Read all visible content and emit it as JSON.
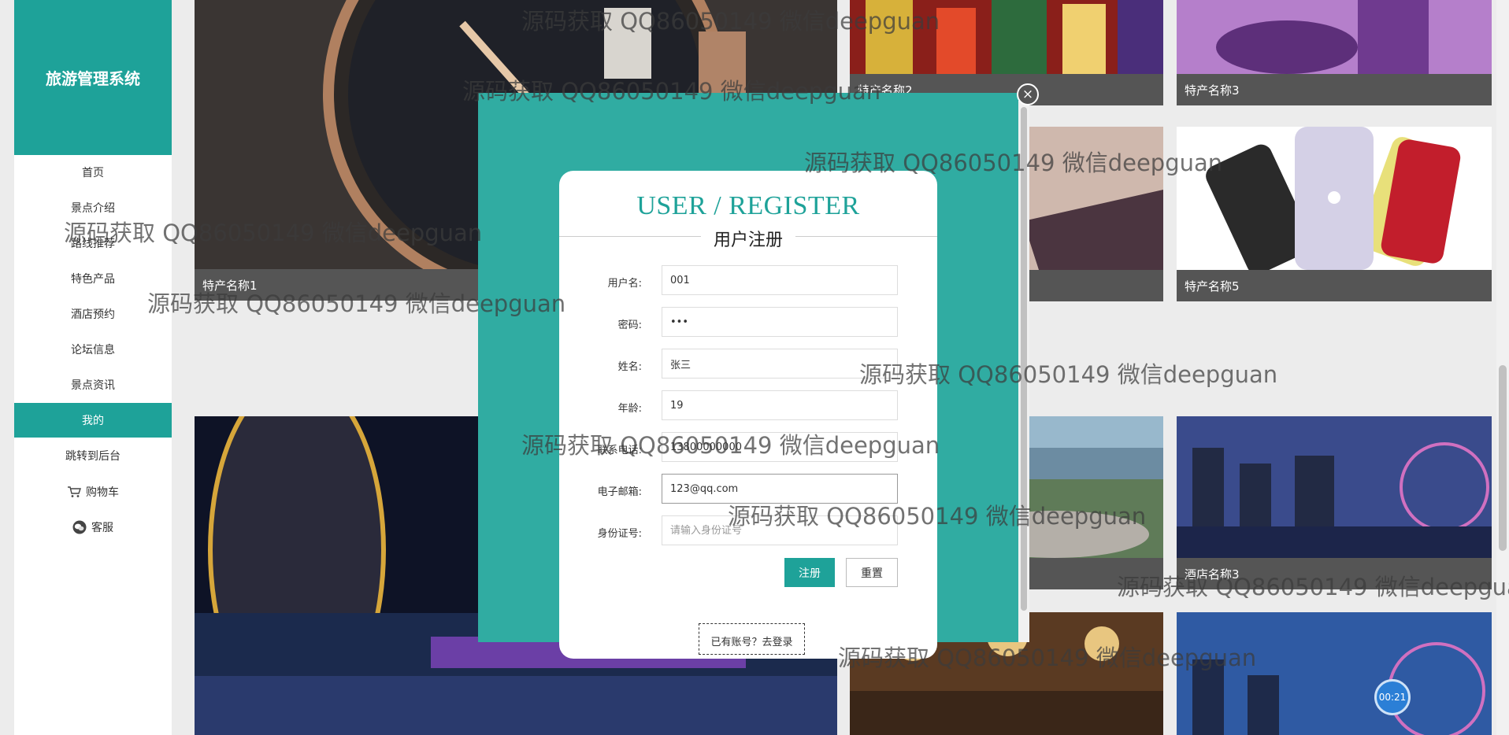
{
  "app": {
    "brand": "旅游管理系统"
  },
  "sidebar": {
    "items": [
      {
        "label": "首页"
      },
      {
        "label": "景点介绍"
      },
      {
        "label": "路线推荐"
      },
      {
        "label": "特色产品"
      },
      {
        "label": "酒店预约"
      },
      {
        "label": "论坛信息"
      },
      {
        "label": "景点资讯"
      },
      {
        "label": "我的"
      },
      {
        "label": "跳转到后台"
      },
      {
        "label": "购物车"
      },
      {
        "label": "客服"
      }
    ]
  },
  "tiles": {
    "product1": "特产名称1",
    "product2": "特产名称2",
    "product3": "特产名称3",
    "product5": "特产名称5",
    "hotel3": "酒店名称3"
  },
  "modal": {
    "close": "×",
    "title": "USER / REGISTER",
    "subtitle": "用户注册",
    "fields": {
      "username": {
        "label": "用户名:",
        "value": "001"
      },
      "password": {
        "label": "密码:",
        "value": "•••"
      },
      "name": {
        "label": "姓名:",
        "value": "张三"
      },
      "age": {
        "label": "年龄:",
        "value": "19"
      },
      "phone": {
        "label": "联系电话:",
        "value": "13800000000"
      },
      "email": {
        "label": "电子邮箱:",
        "value": "123@qq.com"
      },
      "idcard": {
        "label": "身份证号:",
        "value": "",
        "placeholder": "请输入身份证号"
      }
    },
    "register_button": "注册",
    "reset_button": "重置",
    "login_link": "已有账号？去登录"
  },
  "timer": "00:21",
  "watermark": "源码获取 QQ86050149 微信deepguan"
}
